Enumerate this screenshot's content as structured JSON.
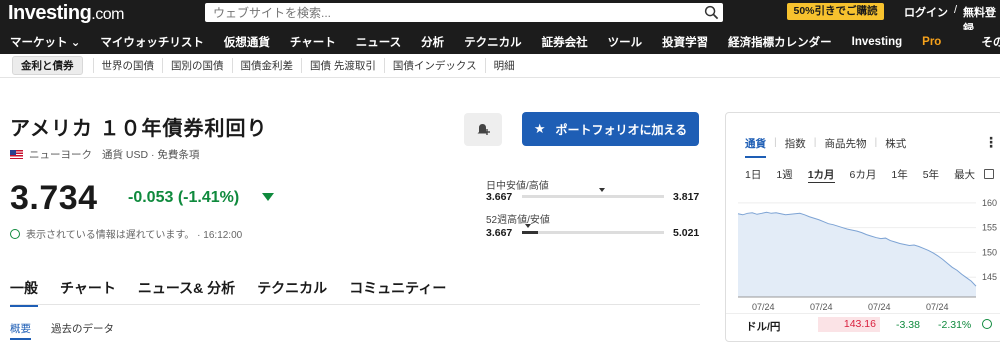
{
  "header": {
    "logo_main": "Investing",
    "logo_suffix": ".com",
    "search_placeholder": "ウェブサイトを検索...",
    "promo": "50%引きでご購読",
    "login": "ログイン",
    "separator": "/",
    "register": "無料登録"
  },
  "nav": {
    "items": [
      "マーケット ⌄",
      "マイウォッチリスト",
      "仮想通貨",
      "チャート",
      "ニュース",
      "分析",
      "テクニカル",
      "証券会社",
      "ツール",
      "投資学習",
      "経済指標カレンダー"
    ],
    "pro_main": "Investing",
    "pro_suffix": "Pro",
    "more": "その他 ⌄"
  },
  "subnav": {
    "active": "金利と債券",
    "items": [
      "世界の国債",
      "国別の国債",
      "国債金利差",
      "国債 先渡取引",
      "国債インデックス",
      "明細"
    ]
  },
  "instrument": {
    "title": "アメリカ １０年債券利回り",
    "exchange": "ニューヨーク",
    "currency": "通貨 USD · 免費条項",
    "price": "3.734",
    "change": "-0.053 (-1.41%)",
    "delay_note": "表示されている情報は遅れています。 · 16:12:00",
    "change_color": "#0f8a3d"
  },
  "actions": {
    "alert_icon": "bell-plus-icon",
    "portfolio_label": "ポートフォリオに加える",
    "portfolio_color": "#1e5eb5"
  },
  "ranges": {
    "day_label": "日中安値/高値",
    "day_low": "3.667",
    "day_high": "3.817",
    "day_position": 0.56,
    "week52_label": "52週高値/安値",
    "week52_low": "3.667",
    "week52_high": "5.021",
    "week52_position": 0.04
  },
  "tabs": {
    "items": [
      "一般",
      "チャート",
      "ニュース& 分析",
      "テクニカル",
      "コミュニティー"
    ],
    "active": "一般",
    "subtabs": [
      "概要",
      "過去のデータ"
    ]
  },
  "panel": {
    "tabs": [
      "通貨",
      "指数",
      "商品先物",
      "株式"
    ],
    "active_tab": "通貨",
    "divider": "|",
    "menu": "⋮",
    "ranges": [
      "1日",
      "1週",
      "1カ月",
      "6カ月",
      "1年",
      "5年",
      "最大"
    ],
    "active_range": "1カ月",
    "quote": {
      "name": "ドル/円",
      "price": "143.16",
      "change": "-3.38",
      "pct": "-2.31%"
    }
  },
  "chart_data": {
    "type": "area",
    "series": [
      {
        "values": [
          157.8,
          157.6,
          157.9,
          158.0,
          157.7,
          157.9,
          158.1,
          157.9,
          158.0,
          157.8,
          157.6,
          157.7,
          157.8,
          157.9,
          157.6,
          157.2,
          156.9,
          156.6,
          156.2,
          155.8,
          155.6,
          155.3,
          155.0,
          154.7,
          154.5,
          154.3,
          154.0,
          153.6,
          153.3,
          153.0,
          152.8,
          152.9,
          152.4,
          152.1,
          151.8,
          151.6,
          151.4,
          151.5,
          151.2,
          150.8,
          150.4,
          149.9,
          149.3,
          148.6,
          147.8,
          147.0,
          146.4,
          145.6,
          144.9,
          144.2,
          143.2
        ]
      }
    ],
    "x_labels": [
      "07/24",
      "07/24",
      "07/24",
      "07/24"
    ],
    "y_ticks": [
      "160",
      "155",
      "150",
      "145"
    ],
    "ylim": [
      141,
      162
    ],
    "grid": true
  }
}
